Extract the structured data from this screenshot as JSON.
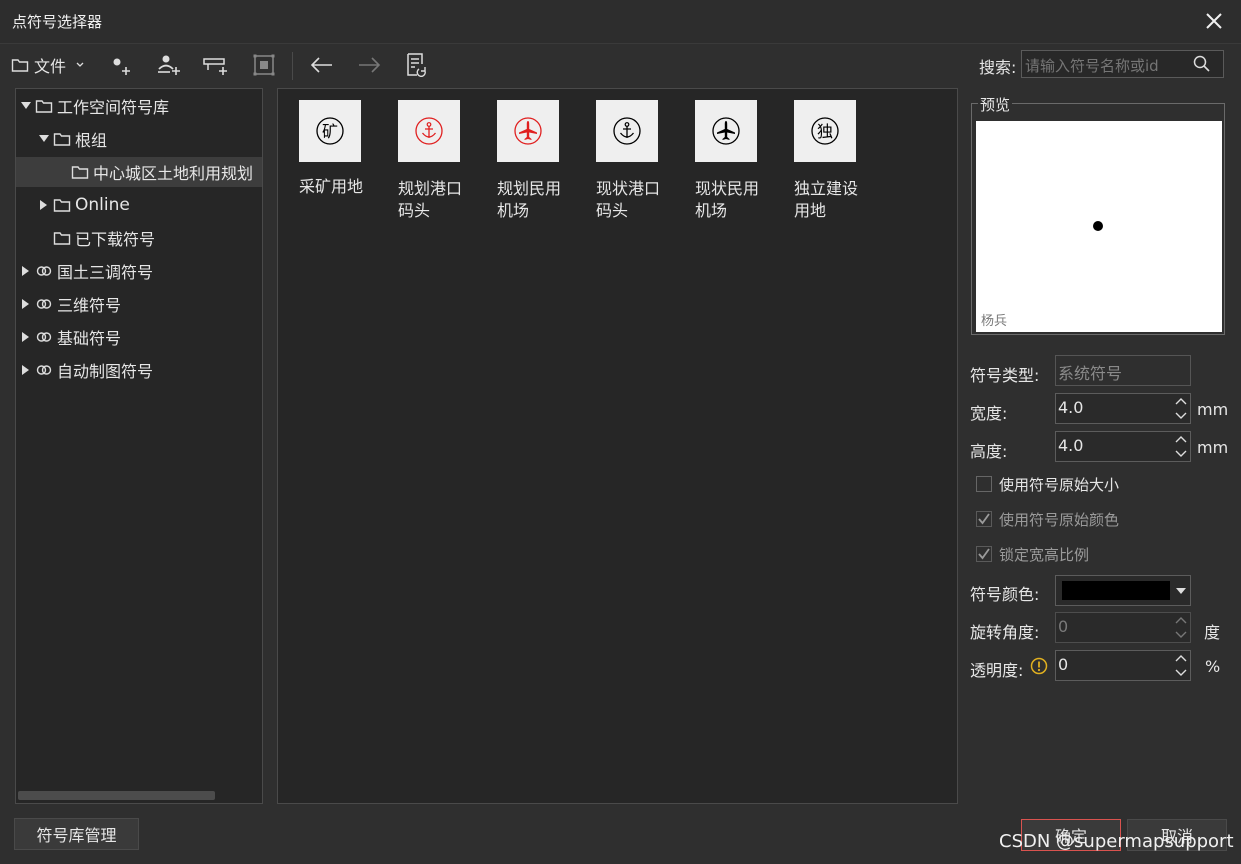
{
  "window": {
    "title": "点符号选择器"
  },
  "toolbar": {
    "file_menu": "文件",
    "search_label": "搜索:",
    "search_placeholder": "请输入符号名称或id"
  },
  "tree": [
    {
      "label": "工作空间符号库"
    },
    {
      "label": "根组"
    },
    {
      "label": "中心城区土地利用规划"
    },
    {
      "label": "Online"
    },
    {
      "label": "已下载符号"
    },
    {
      "label": "国土三调符号"
    },
    {
      "label": "三维符号"
    },
    {
      "label": "基础符号"
    },
    {
      "label": "自动制图符号"
    }
  ],
  "symbols": [
    {
      "label": "采矿用地",
      "glyph": "矿",
      "color": "#000000"
    },
    {
      "label": "规划港口码头",
      "line1": "规划港口",
      "line2": "码头",
      "color": "#e02020"
    },
    {
      "label": "规划民用机场",
      "line1": "规划民用",
      "line2": "机场",
      "color": "#e02020"
    },
    {
      "label": "现状港口码头",
      "line1": "现状港口",
      "line2": "码头",
      "color": "#000000"
    },
    {
      "label": "现状民用机场",
      "line1": "现状民用",
      "line2": "机场",
      "color": "#000000"
    },
    {
      "label": "独立建设用地",
      "line1": "独立建设",
      "line2": "用地",
      "glyph": "独",
      "color": "#000000"
    }
  ],
  "preview": {
    "title": "预览",
    "author": "杨兵"
  },
  "form": {
    "symbol_type_label": "符号类型:",
    "symbol_type_value": "系统符号",
    "width_label": "宽度:",
    "width_value": "4.0",
    "width_unit": "mm",
    "height_label": "高度:",
    "height_value": "4.0",
    "height_unit": "mm",
    "original_size_label": "使用符号原始大小",
    "original_color_label": "使用符号原始颜色",
    "lock_ratio_label": "锁定宽高比例",
    "color_label": "符号颜色:",
    "color_value": "#000000",
    "rotation_label": "旋转角度:",
    "rotation_value": "0",
    "rotation_unit": "度",
    "opacity_label": "透明度:",
    "opacity_value": "0",
    "opacity_unit": "%"
  },
  "buttons": {
    "library_manage": "符号库管理",
    "ok": "确定",
    "cancel": "取消"
  },
  "watermark": "CSDN @supermapsupport"
}
